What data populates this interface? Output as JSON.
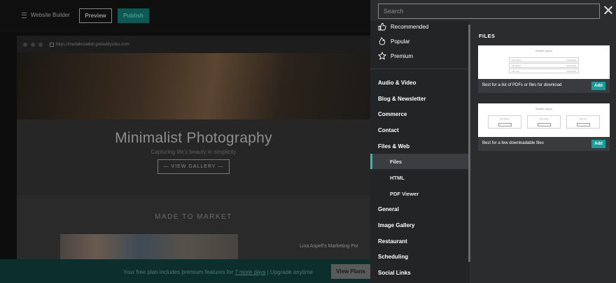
{
  "editor": {
    "app_name": "Website Builder",
    "preview_label": "Preview",
    "publish_label": "Publish",
    "url": "https://medaknowkel.godaddysites.com",
    "site_title": "Minimalist Photography",
    "site_subtitle": "Capturing life's beauty in simplicity",
    "gallery_button": "— VIEW GALLERY —",
    "section_title": "MADE TO MARKET",
    "section_name": "Lina Aspell's Marketing Por"
  },
  "banner": {
    "text_before": "Your free plan includes premium features for ",
    "link": "7 more days",
    "text_after": " | Upgrade anytime",
    "button": "View Plans"
  },
  "panel": {
    "search_placeholder": "Search",
    "favorites": [
      {
        "label": "Recommended",
        "icon": "thumbs-up-icon"
      },
      {
        "label": "Popular",
        "icon": "flame-icon"
      },
      {
        "label": "Premium",
        "icon": "star-icon"
      }
    ],
    "categories": [
      "Audio & Video",
      "Blog & Newsletter",
      "Commerce",
      "Contact",
      "Files & Web",
      "General",
      "Image Gallery",
      "Restaurant",
      "Scheduling",
      "Social Links"
    ],
    "subcategories": [
      "Files",
      "HTML",
      "PDF Viewer"
    ],
    "active_subcategory": "Files",
    "section_heading": "FILES",
    "cards": [
      {
        "description": "Best for a list of PDFs or files for download",
        "add_label": "Add",
        "preview_title": "Browse Layout",
        "preview_rows": [
          {
            "name": "File Name",
            "action": "Download"
          },
          {
            "name": "File guide",
            "action": "Download"
          },
          {
            "name": "File type",
            "action": "Download"
          }
        ]
      },
      {
        "description": "Best for a few downloadable files",
        "add_label": "Add",
        "preview_title": "Browse Layout",
        "preview_items": [
          "File Name",
          "File guide",
          "File type"
        ]
      }
    ]
  },
  "colors": {
    "accent": "#1ec1b7",
    "add_button": "#0fa29a",
    "panel_bg": "#2b2c2e"
  }
}
